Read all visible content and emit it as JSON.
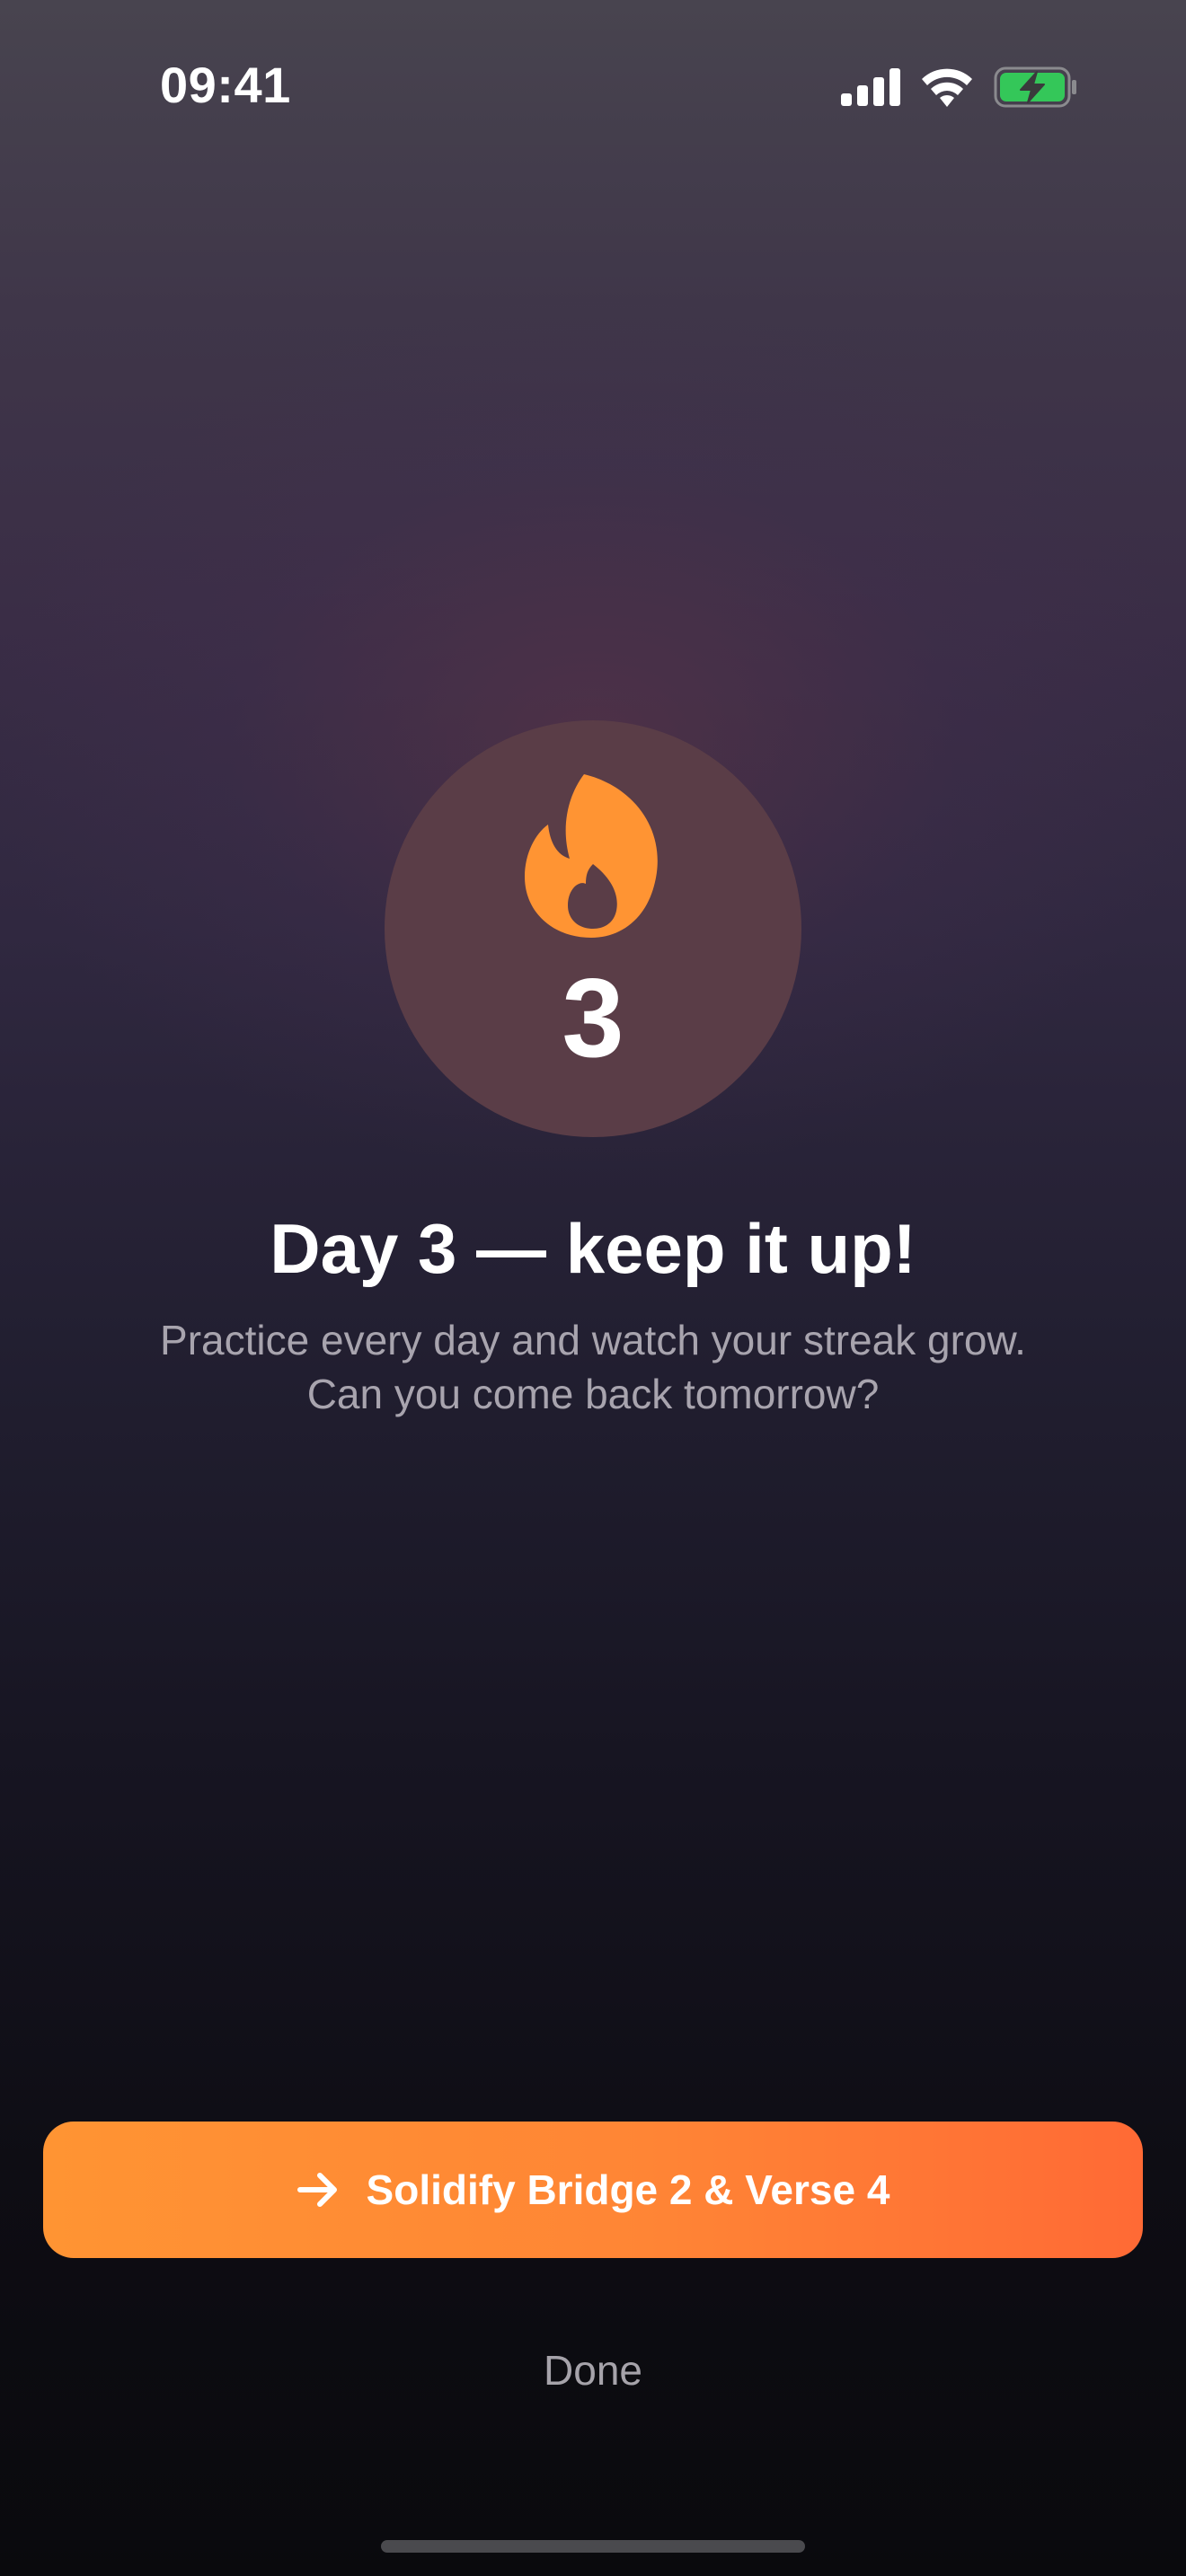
{
  "status_bar": {
    "time": "09:41",
    "signal_icon": "cellular-signal-icon",
    "wifi_icon": "wifi-icon",
    "battery_icon": "battery-charging-icon"
  },
  "streak": {
    "icon": "flame-icon",
    "count": "3",
    "accent_color": "#ff9433"
  },
  "headline": "Day 3 — keep it up!",
  "subtitle": {
    "line1": "Practice every day and watch your streak grow.",
    "line2": "Can you come back tomorrow?"
  },
  "primary_action": {
    "icon": "arrow-right-icon",
    "label": "Solidify Bridge 2 & Verse 4",
    "gradient_start": "#ff9433",
    "gradient_end": "#ff6a35"
  },
  "secondary_action": {
    "label": "Done"
  }
}
